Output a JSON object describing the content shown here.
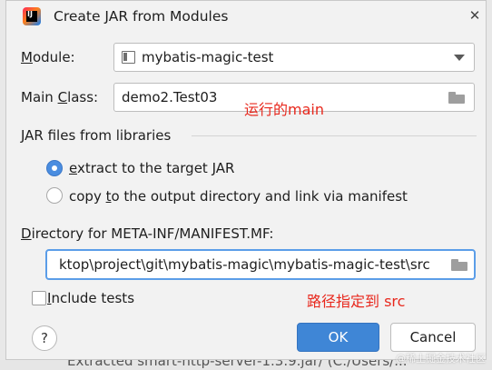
{
  "window": {
    "title": "Create JAR from Modules",
    "close_glyph": "✕",
    "app_icon_text": "IJ"
  },
  "module": {
    "label_mnemonic": "M",
    "label_rest": "odule:",
    "value": "mybatis-magic-test"
  },
  "main_class": {
    "label_before": "Main ",
    "label_mnemonic": "C",
    "label_after": "lass:",
    "value": "demo2.Test03",
    "annotation": "运行的main"
  },
  "libraries": {
    "section_title": "JAR files from libraries",
    "options": [
      {
        "mnemonic": "e",
        "rest": "xtract to the target JAR",
        "selected": true
      },
      {
        "before": "copy ",
        "mnemonic": "t",
        "rest": "o the output directory and link via manifest",
        "selected": false
      }
    ]
  },
  "manifest_dir": {
    "label_mnemonic": "D",
    "label_rest": "irectory for META-INF/MANIFEST.MF:",
    "value": "ktop\\project\\git\\mybatis-magic\\mybatis-magic-test\\src",
    "annotation": "路径指定到 src"
  },
  "include_tests": {
    "label_mnemonic": "I",
    "label_rest": "nclude tests",
    "checked": false
  },
  "buttons": {
    "help": "?",
    "ok": "OK",
    "cancel": "Cancel"
  },
  "background": {
    "text": "Extracted  smart-http-server-1.3.9.jar/  (C:/Users/..."
  },
  "watermark": "@稀土掘金技术社区",
  "colors": {
    "accent": "#3f86d6",
    "annotation": "#e8281d",
    "focus_border": "#5b9de8"
  }
}
